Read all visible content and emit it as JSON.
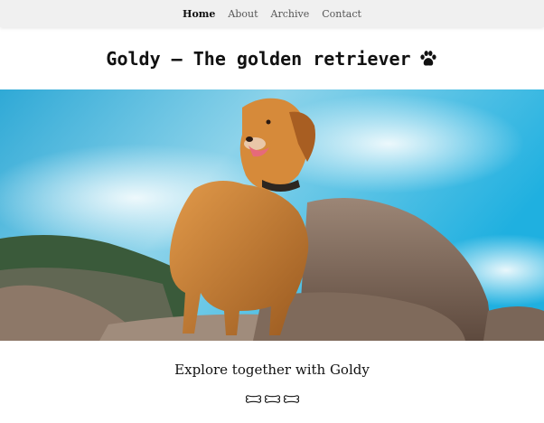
{
  "nav": {
    "items": [
      {
        "label": "Home",
        "active": true
      },
      {
        "label": "About",
        "active": false
      },
      {
        "label": "Archive",
        "active": false
      },
      {
        "label": "Contact",
        "active": false
      }
    ]
  },
  "header": {
    "title": "Goldy – The golden retriever",
    "icon": "paw-icon"
  },
  "hero": {
    "image": "golden-retriever-on-rocks"
  },
  "main": {
    "subtitle": "Explore together with Goldy",
    "divider_icons": [
      "bone-icon",
      "bone-icon",
      "bone-icon"
    ]
  },
  "colors": {
    "nav_bg": "#f0f0f0",
    "text": "#111111",
    "sky": "#3fb6df",
    "dog": "#c77a2e",
    "rock": "#8a7464"
  }
}
